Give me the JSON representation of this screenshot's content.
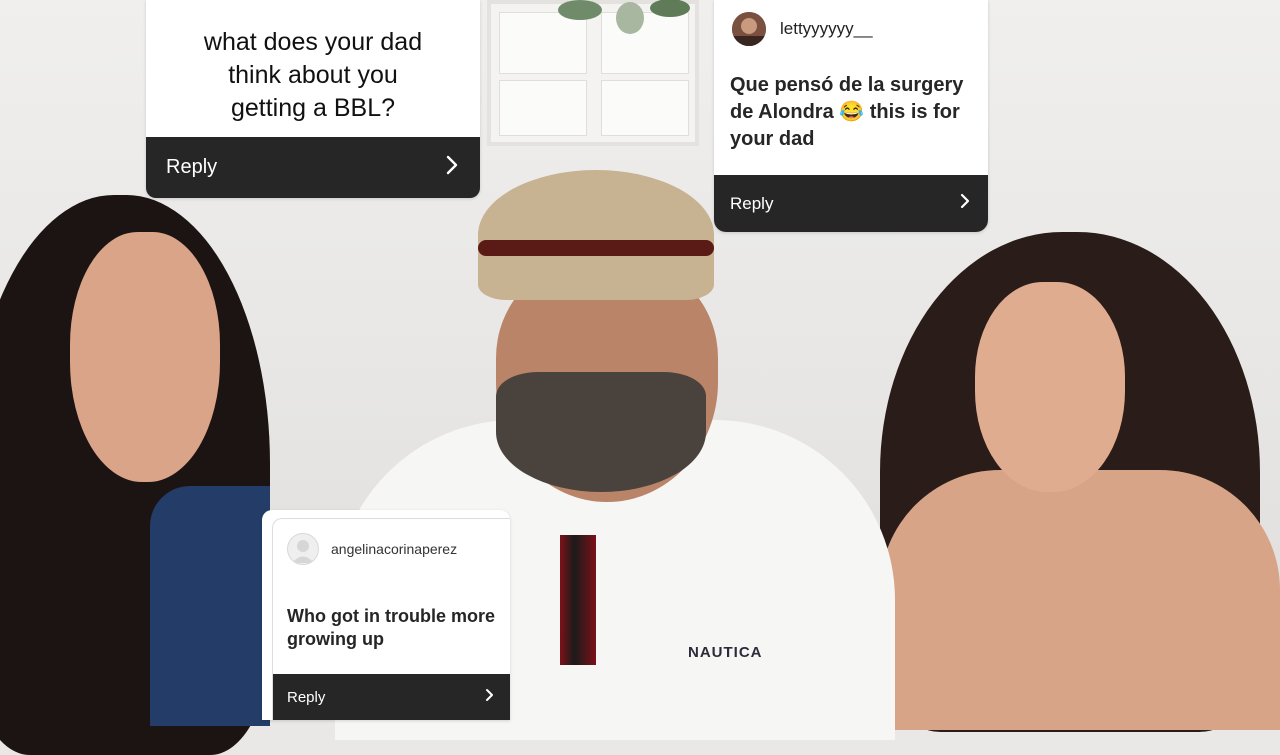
{
  "scene": {
    "shirt_logo": "NAUTICA"
  },
  "cards": [
    {
      "question": "what does your dad\nthink about you\ngetting a  BBL?",
      "reply_label": "Reply",
      "chevron_icon": "chevron-right-icon"
    },
    {
      "username": "lettyyyyyy__",
      "question": "Que pensó de la surgery de Alondra 😂 this is for your dad",
      "reply_label": "Reply",
      "chevron_icon": "chevron-right-icon"
    },
    {
      "username": "angelinacorinaperez",
      "question": "Who got in trouble more growing up",
      "reply_label": "Reply",
      "chevron_icon": "chevron-right-icon"
    }
  ],
  "colors": {
    "reply_bar": "#262626",
    "card_bg": "#ffffff",
    "text_dark": "#262626"
  }
}
